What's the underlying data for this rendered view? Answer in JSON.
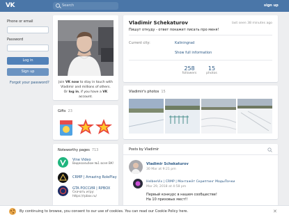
{
  "header": {
    "logo": "VK",
    "search_placeholder": "Search",
    "signup_label": "sign up"
  },
  "login": {
    "phone_label": "Phone or email",
    "password_label": "Password",
    "login_button": "Log in",
    "signup_button": "Sign up",
    "forgot_link": "Forgot your password?"
  },
  "profile_card": {
    "join_line1_pre": "Join ",
    "join_line1_bold": "VK now",
    "join_line1_post": " to stay in touch with",
    "join_line2": "Vladimir and millions of others.",
    "join_line3_pre": "Or ",
    "join_line3_bold1": "log in",
    "join_line3_mid": ", if you have a ",
    "join_line3_bold2": "VK",
    "join_line3_post": " account."
  },
  "gifts": {
    "title": "Gifts",
    "count": "23"
  },
  "noteworthy": {
    "title": "Noteworthy pages",
    "count": "713",
    "items": [
      {
        "name": "Vine Video",
        "desc": "Видеоальбом №1 всея ВК!",
        "color": "#1fb57e"
      },
      {
        "name": "CRMP | Amazing RolePlay",
        "desc": "",
        "color": "#111111"
      },
      {
        "name": "GTA РОССИЯ | RPBOX",
        "desc": "Скачать игру:",
        "desc2": "https://rpbox.ru/",
        "color": "#1d2c66"
      }
    ]
  },
  "profile": {
    "name": "Vladimir Schekaturov",
    "last_seen": "last seen 38 minutes ago",
    "status": "Пишут откуду - ответ покажет писать про меня!",
    "city_label": "Current city:",
    "city_value": "Kaliningrad",
    "full_info": "Show full information",
    "followers_count": "258",
    "followers_label": "followers",
    "photos_count": "15",
    "photos_label": "photos"
  },
  "photos": {
    "title": "Vladimir's photos",
    "count": "15"
  },
  "posts": {
    "title": "Posts by Vladimir",
    "author": "Vladimir Schekaturov",
    "date": "30 Mar at 9:21 pm",
    "repost_name": "HelbeeVix | CRMP | Монтажёт Скриптинг МодыПачки",
    "repost_date": "Mar 29, 2018 at 4:58 pm",
    "text_line1": "Первый конкурс в нашем сообществе!",
    "text_line2": "На 10 призовых мест!!"
  },
  "cookie": {
    "text": "By continuing to browse, you consent to our use of cookies. You can read our Cookie Policy here.",
    "close": "✕"
  },
  "colors": {
    "brand_blue": "#4a76a8",
    "button_blue": "#5181b8",
    "link_blue": "#2a5885",
    "page_bg": "#edeef0"
  }
}
